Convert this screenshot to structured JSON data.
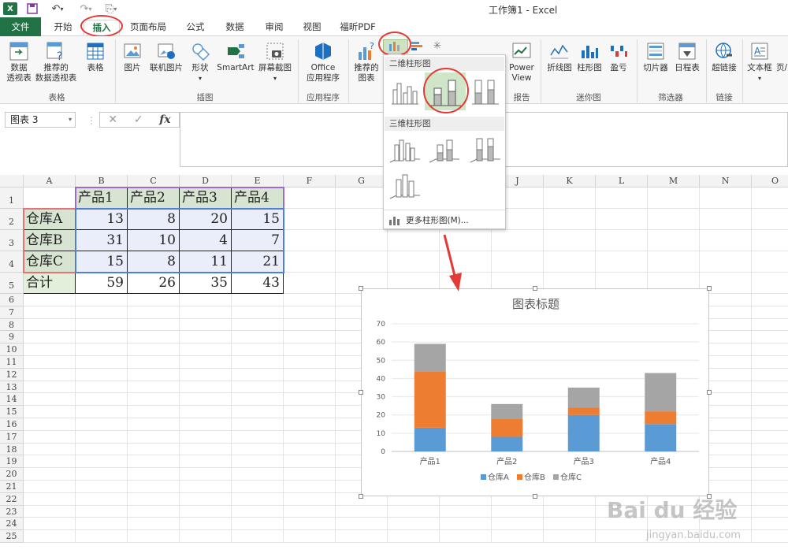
{
  "window": {
    "title": "工作簿1 - Excel"
  },
  "tabs": [
    {
      "id": "file",
      "label": "文件"
    },
    {
      "id": "home",
      "label": "开始"
    },
    {
      "id": "insert",
      "label": "插入"
    },
    {
      "id": "layout",
      "label": "页面布局"
    },
    {
      "id": "formulas",
      "label": "公式"
    },
    {
      "id": "data",
      "label": "数据"
    },
    {
      "id": "review",
      "label": "审阅"
    },
    {
      "id": "view",
      "label": "视图"
    },
    {
      "id": "foxit",
      "label": "福昕PDF"
    }
  ],
  "ribbon": {
    "pivot": "数据\n透视表",
    "rec_pivot": "推荐的\n数据透视表",
    "table": "表格",
    "group_table": "表格",
    "picture": "图片",
    "online_picture": "联机图片",
    "shapes": "形状",
    "smartart": "SmartArt",
    "screenshot": "屏幕截图",
    "group_illus": "插图",
    "office_apps": "Office\n应用程序",
    "group_apps": "应用程序",
    "rec_charts": "推荐的\n图表",
    "powerview": "Power\nView",
    "group_reports": "报告",
    "line": "折线图",
    "column": "柱形图",
    "winloss": "盈亏",
    "group_spark": "迷你图",
    "slicer": "切片器",
    "timeline": "日程表",
    "group_filter": "筛选器",
    "hyperlink": "超链接",
    "group_links": "链接",
    "textbox": "文本框",
    "header_partial": "页/"
  },
  "formula_bar": {
    "name_box": "图表 3",
    "fx": "fx"
  },
  "columns": [
    "A",
    "B",
    "C",
    "D",
    "E",
    "F",
    "G",
    "H",
    "I",
    "J",
    "K",
    "L",
    "M",
    "N",
    "O"
  ],
  "rows": [
    "1",
    "2",
    "3",
    "4",
    "5",
    "6",
    "7",
    "8",
    "9",
    "10",
    "11",
    "12",
    "13",
    "14",
    "15",
    "16",
    "17",
    "18",
    "19",
    "20",
    "21",
    "22",
    "23",
    "24",
    "25"
  ],
  "table": {
    "headers": [
      "产品1",
      "产品2",
      "产品3",
      "产品4"
    ],
    "rows": [
      {
        "label": "仓库A",
        "values": [
          "13",
          "8",
          "20",
          "15"
        ]
      },
      {
        "label": "仓库B",
        "values": [
          "31",
          "10",
          "4",
          "7"
        ]
      },
      {
        "label": "仓库C",
        "values": [
          "15",
          "8",
          "11",
          "21"
        ]
      },
      {
        "label": "合计",
        "values": [
          "59",
          "26",
          "35",
          "43"
        ]
      }
    ]
  },
  "dropdown": {
    "section_2d": "二维柱形图",
    "section_3d": "三维柱形图",
    "more": "更多柱形图(M)..."
  },
  "colors": {
    "excel_green": "#217346",
    "series_a": "#5b9bd5",
    "series_b": "#ed7d31",
    "series_c": "#a5a5a5",
    "highlight": "#e53935"
  },
  "chart_data": {
    "type": "bar",
    "stacked": true,
    "title": "图表标题",
    "categories": [
      "产品1",
      "产品2",
      "产品3",
      "产品4"
    ],
    "series": [
      {
        "name": "仓库A",
        "values": [
          13,
          8,
          20,
          15
        ],
        "color": "#5b9bd5"
      },
      {
        "name": "仓库B",
        "values": [
          31,
          10,
          4,
          7
        ],
        "color": "#ed7d31"
      },
      {
        "name": "仓库C",
        "values": [
          15,
          8,
          11,
          21
        ],
        "color": "#a5a5a5"
      }
    ],
    "ylim": [
      0,
      70
    ],
    "yticks": [
      0,
      10,
      20,
      30,
      40,
      50,
      60,
      70
    ],
    "grid": true,
    "legend": "bottom"
  },
  "watermark": {
    "brand": "Bai du 经验",
    "url": "jingyan.baidu.com"
  }
}
